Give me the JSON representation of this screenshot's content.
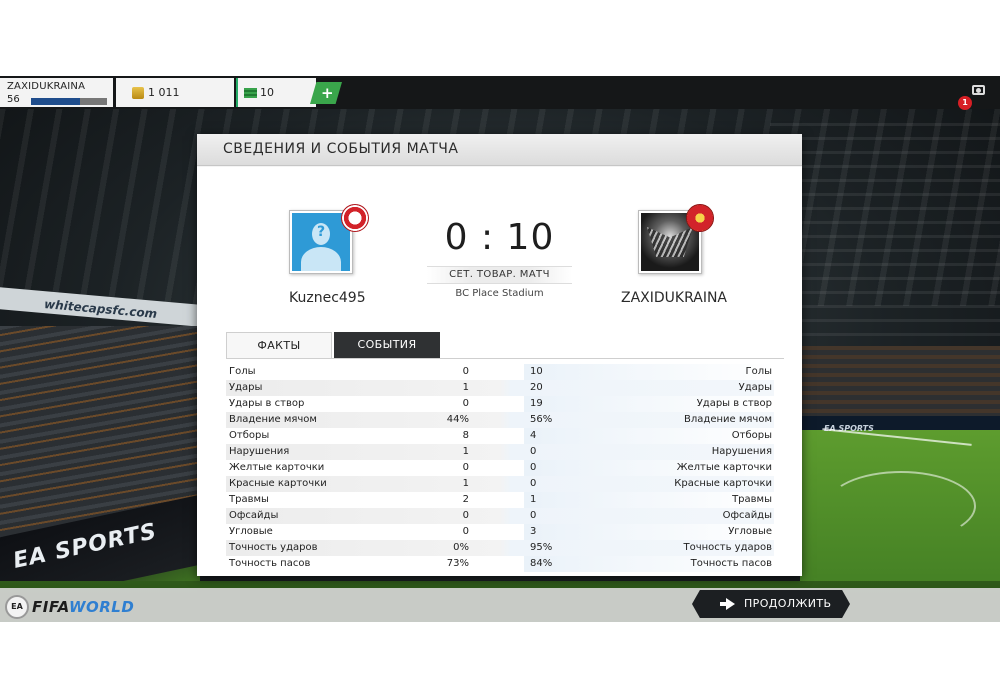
{
  "topbar": {
    "username": "ZAXIDUKRAINA",
    "level": "56",
    "xp_progress": 0.65,
    "coins": "1 011",
    "cash": "10",
    "add_label": "+",
    "notifications": "1"
  },
  "background": {
    "banner_text": "whitecapsfc.com",
    "ad_text": "EA SPORTS",
    "board_text": "EA SPORTS"
  },
  "dialog": {
    "title": "СВЕДЕНИЯ И СОБЫТИЯ МАТЧА",
    "home_team": "Kuznec495",
    "away_team": "ZAXIDUKRAINA",
    "score": "0 : 10",
    "match_type": "СЕТ. ТОВАР. МАТЧ",
    "stadium": "BC Place Stadium",
    "home_avatar_text": "?",
    "tabs": {
      "facts": "ФАКТЫ",
      "events": "СОБЫТИЯ"
    },
    "stats": [
      {
        "label": "Голы",
        "home": "0",
        "away": "10"
      },
      {
        "label": "Удары",
        "home": "1",
        "away": "20"
      },
      {
        "label": "Удары в створ",
        "home": "0",
        "away": "19"
      },
      {
        "label": "Владение мячом",
        "home": "44%",
        "away": "56%"
      },
      {
        "label": "Отборы",
        "home": "8",
        "away": "4"
      },
      {
        "label": "Нарушения",
        "home": "1",
        "away": "0"
      },
      {
        "label": "Желтые карточки",
        "home": "0",
        "away": "0"
      },
      {
        "label": "Красные карточки",
        "home": "1",
        "away": "0"
      },
      {
        "label": "Травмы",
        "home": "2",
        "away": "1"
      },
      {
        "label": "Офсайды",
        "home": "0",
        "away": "0"
      },
      {
        "label": "Угловые",
        "home": "0",
        "away": "3"
      },
      {
        "label": "Точность ударов",
        "home": "0%",
        "away": "95%"
      },
      {
        "label": "Точность пасов",
        "home": "73%",
        "away": "84%"
      }
    ]
  },
  "footer": {
    "logo_badge": "EA",
    "logo_main": "FIFA",
    "logo_accent": "WORLD",
    "continue_label": "ПРОДОЛЖИТЬ"
  }
}
